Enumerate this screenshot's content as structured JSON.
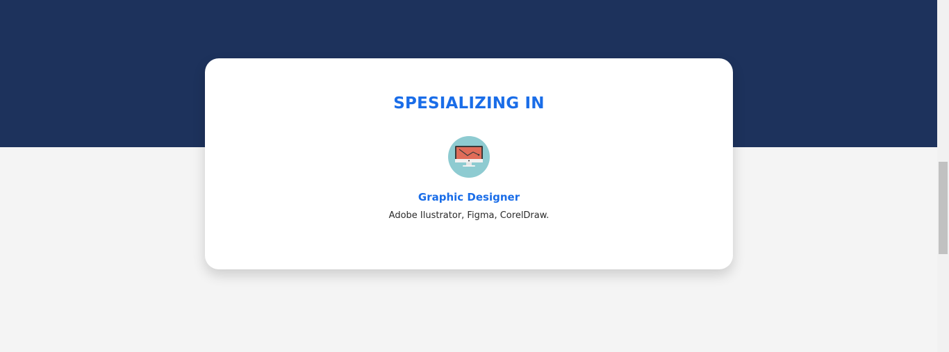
{
  "section": {
    "title": "SPESIALIZING IN"
  },
  "skill": {
    "icon": "monitor-graphic-icon",
    "title": "Graphic Designer",
    "description": "Adobe Ilustrator, Figma, CorelDraw."
  },
  "colors": {
    "hero_background": "#1d325c",
    "page_background": "#f4f4f4",
    "accent": "#1a6de8",
    "icon_circle": "#8ecbd1",
    "icon_screen": "#e06c59"
  }
}
